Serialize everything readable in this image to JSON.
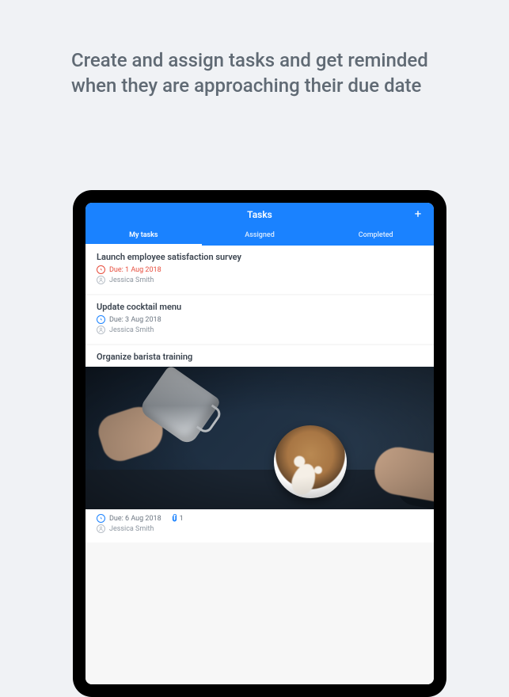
{
  "marketing_copy": "Create and assign tasks and get reminded when they are approaching their due date",
  "header": {
    "title": "Tasks",
    "add_label": "+"
  },
  "tabs": [
    {
      "label": "My tasks",
      "active": true
    },
    {
      "label": "Assigned",
      "active": false
    },
    {
      "label": "Completed",
      "active": false
    }
  ],
  "tasks": [
    {
      "title": "Launch employee satisfaction survey",
      "due_label": "Due: 1 Aug 2018",
      "assignee": "Jessica Smith",
      "overdue": true,
      "has_image": false
    },
    {
      "title": "Update cocktail menu",
      "due_label": "Due: 3 Aug 2018",
      "assignee": "Jessica Smith",
      "overdue": false,
      "has_image": false
    },
    {
      "title": "Organize barista training",
      "due_label": "Due: 6 Aug 2018",
      "assignee": "Jessica Smith",
      "overdue": false,
      "has_image": true,
      "attachment_count": "1"
    }
  ],
  "icons": {
    "clock": "clock-icon",
    "user": "user-icon",
    "add": "plus-icon",
    "attach": "paperclip-icon"
  }
}
